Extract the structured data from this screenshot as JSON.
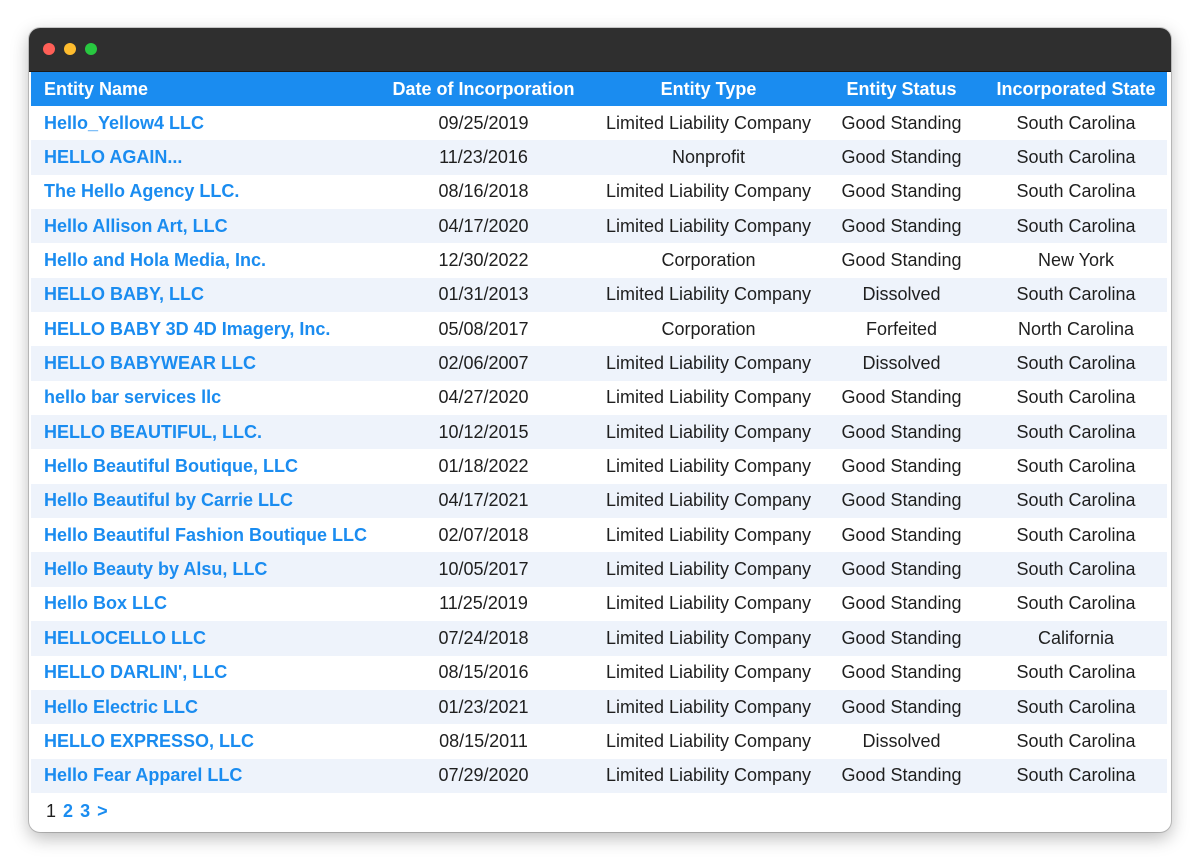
{
  "table": {
    "headers": [
      "Entity Name",
      "Date of Incorporation",
      "Entity Type",
      "Entity Status",
      "Incorporated State"
    ],
    "rows": [
      [
        "Hello_Yellow4 LLC",
        "09/25/2019",
        "Limited Liability Company",
        "Good Standing",
        "South Carolina"
      ],
      [
        "HELLO AGAIN...",
        "11/23/2016",
        "Nonprofit",
        "Good Standing",
        "South Carolina"
      ],
      [
        "The Hello Agency LLC.",
        "08/16/2018",
        "Limited Liability Company",
        "Good Standing",
        "South Carolina"
      ],
      [
        "Hello Allison Art, LLC",
        "04/17/2020",
        "Limited Liability Company",
        "Good Standing",
        "South Carolina"
      ],
      [
        "Hello and Hola Media, Inc.",
        "12/30/2022",
        "Corporation",
        "Good Standing",
        "New York"
      ],
      [
        "HELLO BABY, LLC",
        "01/31/2013",
        "Limited Liability Company",
        "Dissolved",
        "South Carolina"
      ],
      [
        "HELLO BABY 3D 4D Imagery, Inc.",
        "05/08/2017",
        "Corporation",
        "Forfeited",
        "North Carolina"
      ],
      [
        "HELLO BABYWEAR LLC",
        "02/06/2007",
        "Limited Liability Company",
        "Dissolved",
        "South Carolina"
      ],
      [
        "hello bar services llc",
        "04/27/2020",
        "Limited Liability Company",
        "Good Standing",
        "South Carolina"
      ],
      [
        "HELLO BEAUTIFUL, LLC.",
        "10/12/2015",
        "Limited Liability Company",
        "Good Standing",
        "South Carolina"
      ],
      [
        "Hello Beautiful Boutique, LLC",
        "01/18/2022",
        "Limited Liability Company",
        "Good Standing",
        "South Carolina"
      ],
      [
        "Hello Beautiful by Carrie LLC",
        "04/17/2021",
        "Limited Liability Company",
        "Good Standing",
        "South Carolina"
      ],
      [
        "Hello Beautiful Fashion Boutique LLC",
        "02/07/2018",
        "Limited Liability Company",
        "Good Standing",
        "South Carolina"
      ],
      [
        "Hello Beauty by Alsu, LLC",
        "10/05/2017",
        "Limited Liability Company",
        "Good Standing",
        "South Carolina"
      ],
      [
        "Hello Box LLC",
        "11/25/2019",
        "Limited Liability Company",
        "Good Standing",
        "South Carolina"
      ],
      [
        "HELLOCELLO LLC",
        "07/24/2018",
        "Limited Liability Company",
        "Good Standing",
        "California"
      ],
      [
        "HELLO DARLIN', LLC",
        "08/15/2016",
        "Limited Liability Company",
        "Good Standing",
        "South Carolina"
      ],
      [
        "Hello Electric LLC",
        "01/23/2021",
        "Limited Liability Company",
        "Good Standing",
        "South Carolina"
      ],
      [
        "HELLO EXPRESSO, LLC",
        "08/15/2011",
        "Limited Liability Company",
        "Dissolved",
        "South Carolina"
      ],
      [
        "Hello Fear Apparel LLC",
        "07/29/2020",
        "Limited Liability Company",
        "Good Standing",
        "South Carolina"
      ]
    ]
  },
  "pagination": {
    "current": "1",
    "pages": [
      "2",
      "3"
    ],
    "next": ">"
  },
  "colors": {
    "accent": "#1a8cf0",
    "stripe": "#eef3fb",
    "titlebar": "#2f2f2f"
  }
}
